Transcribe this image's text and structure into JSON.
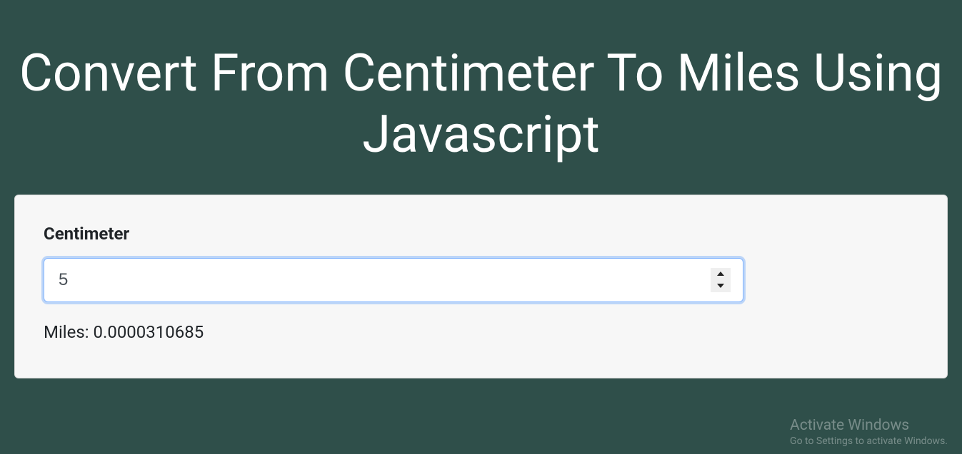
{
  "title": "Convert From Centimeter To Miles Using Javascript",
  "card": {
    "input_label": "Centimeter",
    "input_value": "5",
    "result_label": "Miles: ",
    "result_value": "0.0000310685"
  },
  "watermark": {
    "title": "Activate Windows",
    "subtitle": "Go to Settings to activate Windows."
  }
}
